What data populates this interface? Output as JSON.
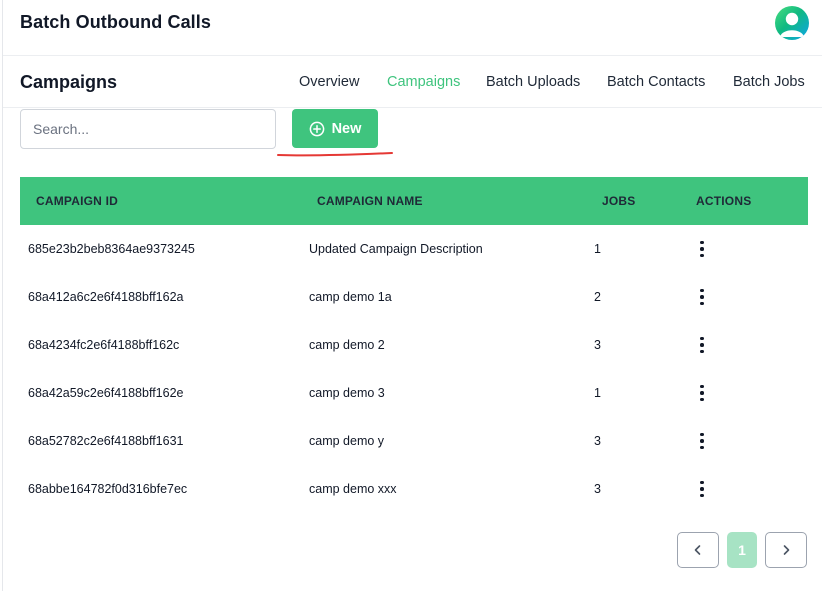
{
  "app": {
    "title": "Batch Outbound Calls"
  },
  "user": {
    "avatar_icon": "user-avatar-icon"
  },
  "page": {
    "title": "Campaigns"
  },
  "tabs": [
    {
      "label": "Overview",
      "active": false
    },
    {
      "label": "Campaigns",
      "active": true
    },
    {
      "label": "Batch Uploads",
      "active": false
    },
    {
      "label": "Batch Contacts",
      "active": false
    },
    {
      "label": "Batch Jobs",
      "active": false
    }
  ],
  "search": {
    "placeholder": "Search...",
    "value": ""
  },
  "toolbar": {
    "new_label": "New",
    "new_icon": "plus-circle-icon"
  },
  "table": {
    "headers": {
      "id": "CAMPAIGN ID",
      "name": "CAMPAIGN NAME",
      "jobs": "JOBS",
      "actions": "ACTIONS"
    },
    "rows": [
      {
        "id": "685e23b2beb8364ae9373245",
        "name": "Updated Campaign Description",
        "jobs": "1"
      },
      {
        "id": "68a412a6c2e6f4188bff162a",
        "name": "camp demo 1a",
        "jobs": "2"
      },
      {
        "id": "68a4234fc2e6f4188bff162c",
        "name": "camp demo 2",
        "jobs": "3"
      },
      {
        "id": "68a42a59c2e6f4188bff162e",
        "name": "camp demo 3",
        "jobs": "1"
      },
      {
        "id": "68a52782c2e6f4188bff1631",
        "name": "camp demo y",
        "jobs": "3"
      },
      {
        "id": "68abbe164782f0d316bfe7ec",
        "name": "camp demo xxx",
        "jobs": "3"
      }
    ]
  },
  "pagination": {
    "current_page": "1",
    "prev_icon": "chevron-left-icon",
    "next_icon": "chevron-right-icon"
  },
  "colors": {
    "accent": "#3fc47e",
    "accent_light": "#a7e3c4",
    "annotation": "#e53935"
  }
}
